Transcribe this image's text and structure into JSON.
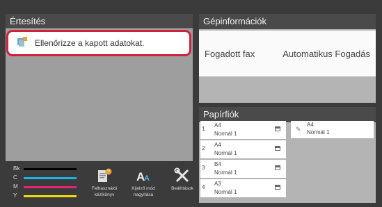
{
  "notification": {
    "title": "Értesítés",
    "message": "Ellenőrizze a kapott adatokat."
  },
  "machine_info": {
    "title": "Gépinformációk",
    "label": "Fogadott fax",
    "value": "Automatikus Fogadás"
  },
  "paper_trays": {
    "title": "Papírfiók",
    "trays": [
      {
        "number": "1",
        "size": "A4",
        "type": "Normál 1"
      },
      {
        "number": "2",
        "size": "A4",
        "type": "Normál 1"
      },
      {
        "number": "3",
        "size": "B4",
        "type": "Normál 1"
      },
      {
        "number": "4",
        "size": "A3",
        "type": "Normál 1"
      }
    ],
    "bypass": {
      "size": "A4",
      "type": "Normál 1"
    }
  },
  "toner": [
    {
      "label": "Bk",
      "color": "#000000"
    },
    {
      "label": "C",
      "color": "#18b4e8"
    },
    {
      "label": "M",
      "color": "#e0267a"
    },
    {
      "label": "Y",
      "color": "#f0e000"
    }
  ],
  "buttons": {
    "manual": "Felhasználói kézikönyv",
    "zoom": "Kijelző mód nagyítása",
    "settings": "Beállítások"
  }
}
